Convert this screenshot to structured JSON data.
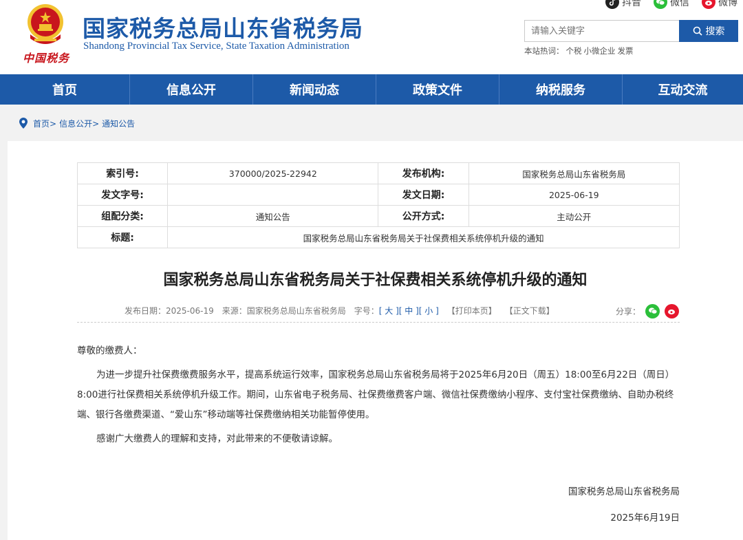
{
  "header": {
    "title": "国家税务总局山东省税务局",
    "subtitle": "Shandong Provincial Tax Service, State Taxation Administration",
    "brand_script": "中国税务",
    "social": [
      {
        "label": "抖音",
        "icon": "douyin-icon",
        "color": "#222222"
      },
      {
        "label": "微信",
        "icon": "wechat-icon",
        "color": "#2bbf3a"
      },
      {
        "label": "微博",
        "icon": "weibo-icon",
        "color": "#e6162d"
      }
    ],
    "search": {
      "placeholder": "请输入关键字",
      "button_label": "搜索"
    },
    "hotwords": {
      "label": "本站热词：",
      "items": [
        "个税",
        "小微企业",
        "发票"
      ]
    }
  },
  "nav": {
    "items": [
      "首页",
      "信息公开",
      "新闻动态",
      "政策文件",
      "纳税服务",
      "互动交流"
    ]
  },
  "breadcrumb": {
    "items": [
      "首页>",
      "信息公开>",
      "通知公告"
    ]
  },
  "meta": {
    "index_label": "索引号:",
    "index_value": "370000/2025-22942",
    "issuer_label": "发布机构:",
    "issuer_value": "国家税务总局山东省税务局",
    "doc_no_label": "发文字号:",
    "doc_no_value": "",
    "date_label": "发文日期:",
    "date_value": "2025-06-19",
    "category_label": "组配分类:",
    "category_value": "通知公告",
    "public_label": "公开方式:",
    "public_value": "主动公开",
    "title_label": "标题:",
    "title_value": "国家税务总局山东省税务局关于社保费相关系统停机升级的通知"
  },
  "article": {
    "title": "国家税务总局山东省税务局关于社保费相关系统停机升级的通知",
    "publish_date": "发布日期：2025-06-19",
    "source": "来源：国家税务总局山东省税务局",
    "font_size_label": "字号：",
    "font_large": "[ 大 ]",
    "font_medium": "[ 中 ]",
    "font_small": "[ 小 ]",
    "print": "【打印本页】",
    "download": "【正文下载】",
    "share_label": "分享：",
    "greeting": "尊敬的缴费人：",
    "para1": "为进一步提升社保费缴费服务水平，提高系统运行效率，国家税务总局山东省税务局将于2025年6月20日（周五）18:00至6月22日（周日）8:00进行社保费相关系统停机升级工作。期间，山东省电子税务局、社保费缴费客户端、微信社保费缴纳小程序、支付宝社保费缴纳、自助办税终端、银行各缴费渠道、“爱山东”移动端等社保费缴纳相关功能暂停使用。",
    "para2": "感谢广大缴费人的理解和支持，对此带来的不便敬请谅解。",
    "sign_org": "国家税务总局山东省税务局",
    "sign_date": "2025年6月19日"
  },
  "colors": {
    "brand_blue": "#1d5aa8",
    "emblem_red": "#c8161d",
    "gold": "#f2c230"
  }
}
